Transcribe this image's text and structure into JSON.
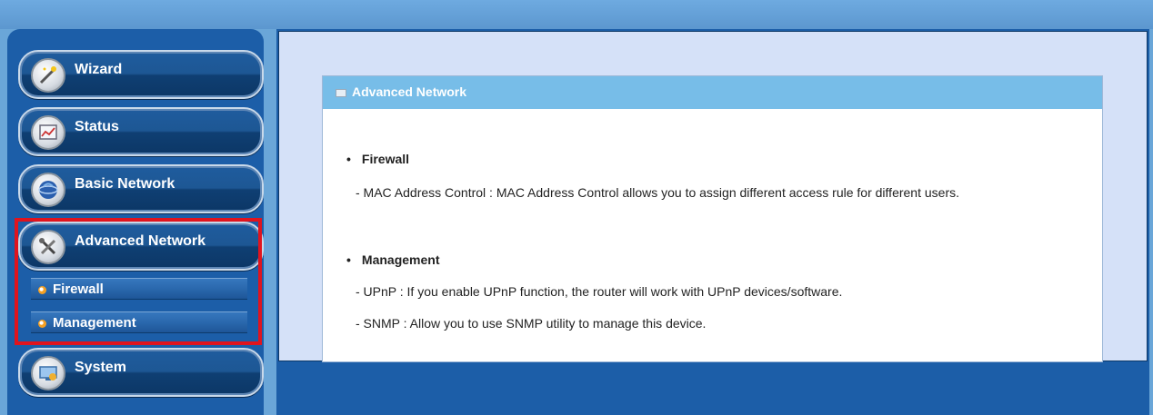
{
  "sidebar": {
    "items": [
      {
        "label": "Wizard",
        "icon": "wand-icon"
      },
      {
        "label": "Status",
        "icon": "chart-icon"
      },
      {
        "label": "Basic Network",
        "icon": "globe-icon"
      },
      {
        "label": "Advanced Network",
        "icon": "tools-icon"
      },
      {
        "label": "System",
        "icon": "system-icon"
      }
    ],
    "subitems": [
      {
        "label": "Firewall"
      },
      {
        "label": "Management"
      }
    ]
  },
  "card": {
    "title": "Advanced Network",
    "sections": [
      {
        "title": "Firewall",
        "lines": [
          "- MAC Address Control : MAC Address Control allows you to assign different access rule for different users."
        ]
      },
      {
        "title": "Management",
        "lines": [
          "- UPnP : If you enable UPnP function, the router will work with UPnP devices/software.",
          "- SNMP : Allow you to use SNMP utility to manage this device."
        ]
      }
    ]
  },
  "colors": {
    "sidebar_bg": "#1c5ea8",
    "panel_bg": "#d5e1f8",
    "header_bg": "#77bde8",
    "highlight": "#e0141e"
  }
}
